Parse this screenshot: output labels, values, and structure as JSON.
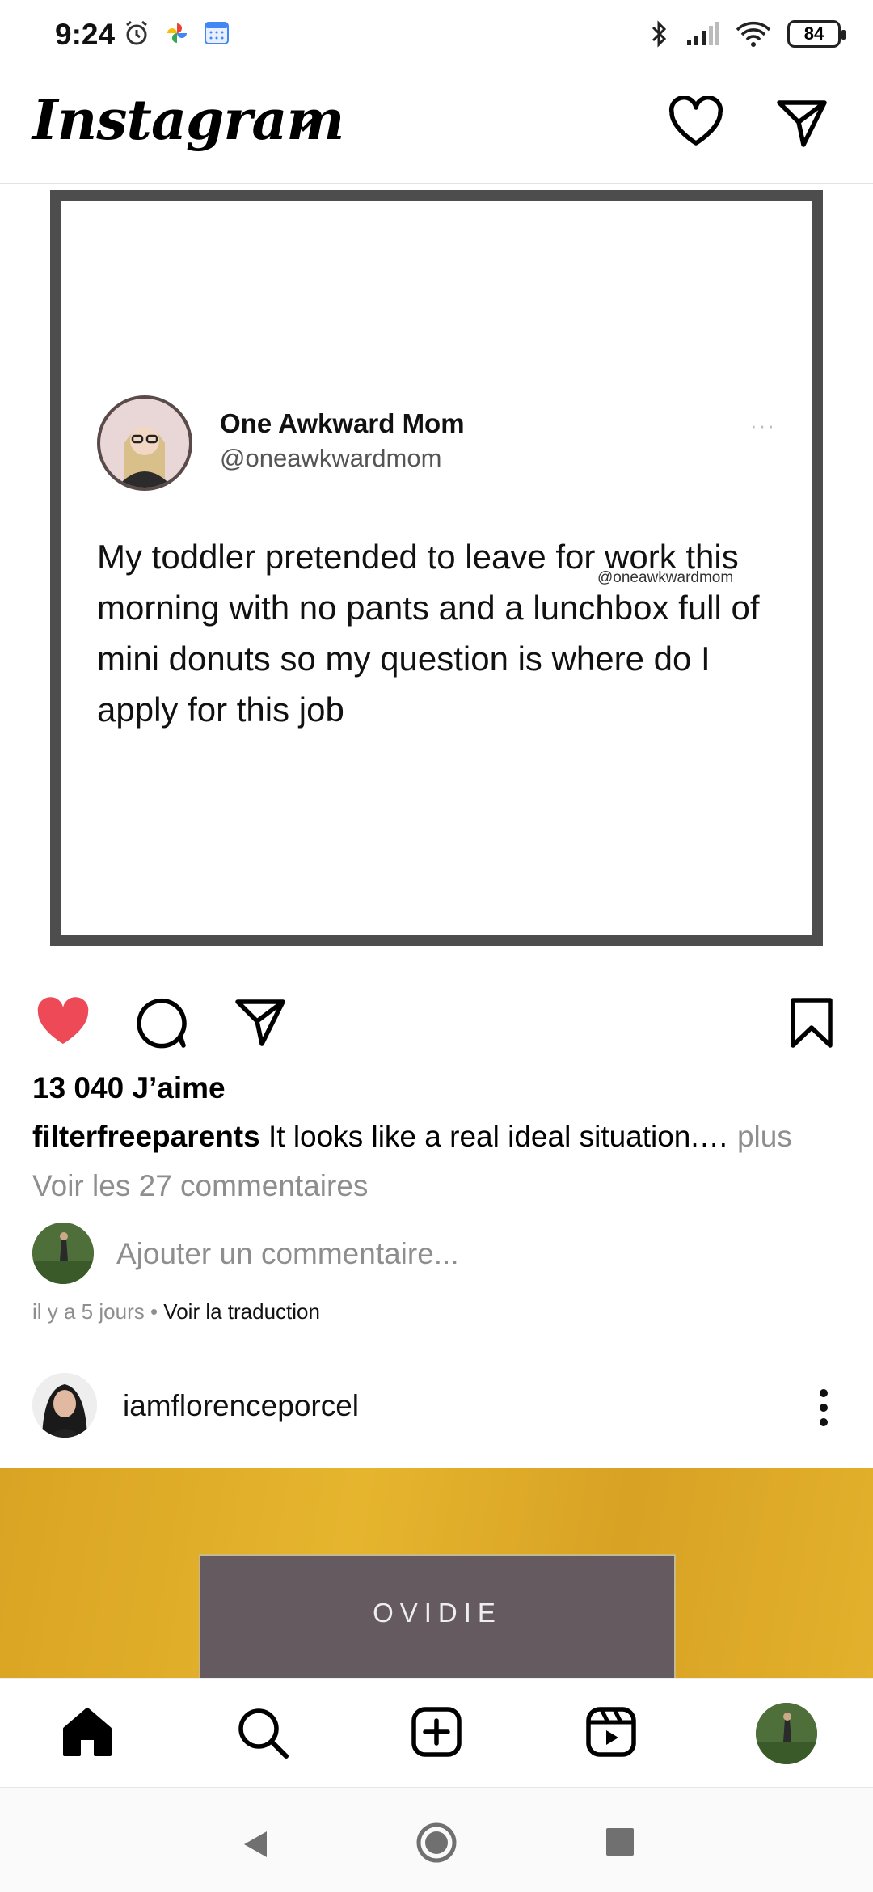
{
  "status_bar": {
    "time": "9:24",
    "battery": "84"
  },
  "header": {
    "logo": "Instagram"
  },
  "post": {
    "tweet": {
      "name": "One Awkward Mom",
      "handle": "@oneawkwardmom",
      "text": "My toddler pretended to leave for work this morning with no pants and a lunchbox full of mini donuts so my question is where do I apply for this job",
      "watermark": "@oneawkwardmom",
      "more_dots": "···"
    },
    "liked": true,
    "likes_label": "13 040 J’aime",
    "caption_user": "filterfreeparents",
    "caption_text": " It looks like a real ideal situation.…",
    "caption_more": " plus",
    "view_comments": "Voir les 27 commentaires",
    "add_comment_placeholder": "Ajouter un commentaire...",
    "time_ago": "il y a 5 jours",
    "separator": " • ",
    "translate": "Voir la traduction"
  },
  "next_post": {
    "username": "iamflorenceporcel",
    "book_title": "OVIDIE"
  },
  "colors": {
    "like_red": "#ed4956",
    "muted": "#8e8e8e"
  }
}
